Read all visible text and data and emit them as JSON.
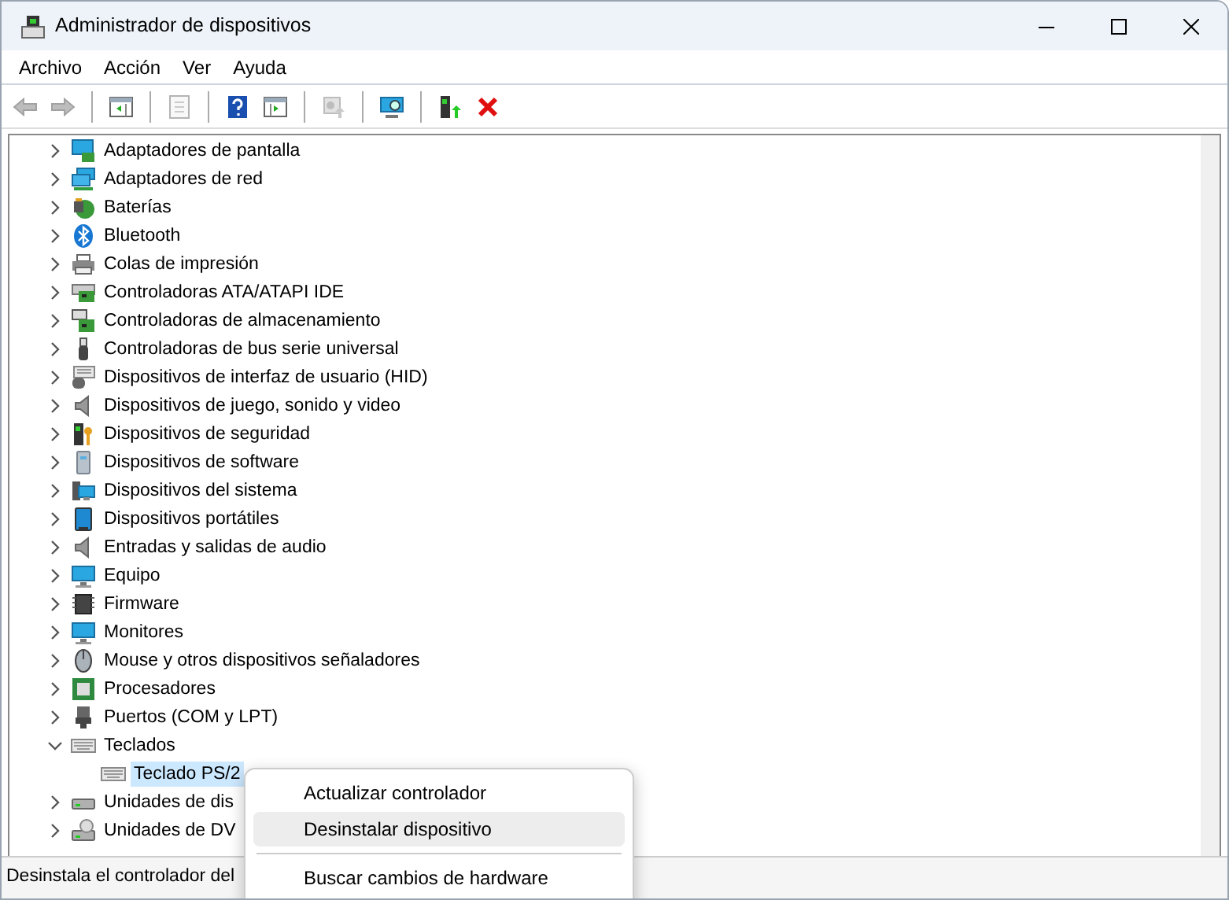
{
  "window": {
    "title": "Administrador de dispositivos"
  },
  "menu_bar": [
    "Archivo",
    "Acción",
    "Ver",
    "Ayuda"
  ],
  "toolbar": [
    {
      "kind": "back",
      "disabled": true
    },
    {
      "kind": "forward",
      "disabled": true
    },
    {
      "kind": "separator"
    },
    {
      "kind": "tree-pane",
      "disabled": false
    },
    {
      "kind": "separator"
    },
    {
      "kind": "properties",
      "disabled": true
    },
    {
      "kind": "separator"
    },
    {
      "kind": "help",
      "disabled": false
    },
    {
      "kind": "action-pane",
      "disabled": false
    },
    {
      "kind": "separator"
    },
    {
      "kind": "update",
      "disabled": true
    },
    {
      "kind": "separator"
    },
    {
      "kind": "scan",
      "disabled": false
    },
    {
      "kind": "separator"
    },
    {
      "kind": "enable",
      "disabled": false
    },
    {
      "kind": "uninstall",
      "disabled": false
    }
  ],
  "tree": [
    {
      "label": "Adaptadores de pantalla",
      "expanded": false,
      "selected": false
    },
    {
      "label": "Adaptadores de red",
      "expanded": false,
      "selected": false
    },
    {
      "label": "Baterías",
      "expanded": false,
      "selected": false
    },
    {
      "label": "Bluetooth",
      "expanded": false,
      "selected": false
    },
    {
      "label": "Colas de impresión",
      "expanded": false,
      "selected": false
    },
    {
      "label": "Controladoras ATA/ATAPI IDE",
      "expanded": false,
      "selected": false
    },
    {
      "label": "Controladoras de almacenamiento",
      "expanded": false,
      "selected": false
    },
    {
      "label": "Controladoras de bus serie universal",
      "expanded": false,
      "selected": false
    },
    {
      "label": "Dispositivos de interfaz de usuario (HID)",
      "expanded": false,
      "selected": false
    },
    {
      "label": "Dispositivos de juego, sonido y video",
      "expanded": false,
      "selected": false
    },
    {
      "label": "Dispositivos de seguridad",
      "expanded": false,
      "selected": false
    },
    {
      "label": "Dispositivos de software",
      "expanded": false,
      "selected": false
    },
    {
      "label": "Dispositivos del sistema",
      "expanded": false,
      "selected": false
    },
    {
      "label": "Dispositivos portátiles",
      "expanded": false,
      "selected": false
    },
    {
      "label": "Entradas y salidas de audio",
      "expanded": false,
      "selected": false
    },
    {
      "label": "Equipo",
      "expanded": false,
      "selected": false
    },
    {
      "label": "Firmware",
      "expanded": false,
      "selected": false
    },
    {
      "label": "Monitores",
      "expanded": false,
      "selected": false
    },
    {
      "label": "Mouse y otros dispositivos señaladores",
      "expanded": false,
      "selected": false
    },
    {
      "label": "Procesadores",
      "expanded": false,
      "selected": false
    },
    {
      "label": "Puertos (COM y LPT)",
      "expanded": false,
      "selected": false
    },
    {
      "label": "Teclados",
      "expanded": true,
      "selected": false,
      "children": [
        {
          "label": "Teclado PS/2",
          "selected": true
        }
      ]
    },
    {
      "label": "Unidades de dis",
      "expanded": false,
      "selected": false
    },
    {
      "label": "Unidades de DV",
      "expanded": false,
      "selected": false
    }
  ],
  "context_menu": {
    "groups": [
      {
        "items": [
          {
            "label": "Actualizar controlador",
            "selected": false
          },
          {
            "label": "Desinstalar dispositivo",
            "selected": true
          }
        ]
      },
      {
        "items": [
          {
            "label": "Buscar cambios de hardware",
            "selected": false
          }
        ]
      }
    ]
  },
  "status_bar": "Desinstala el controlador del"
}
